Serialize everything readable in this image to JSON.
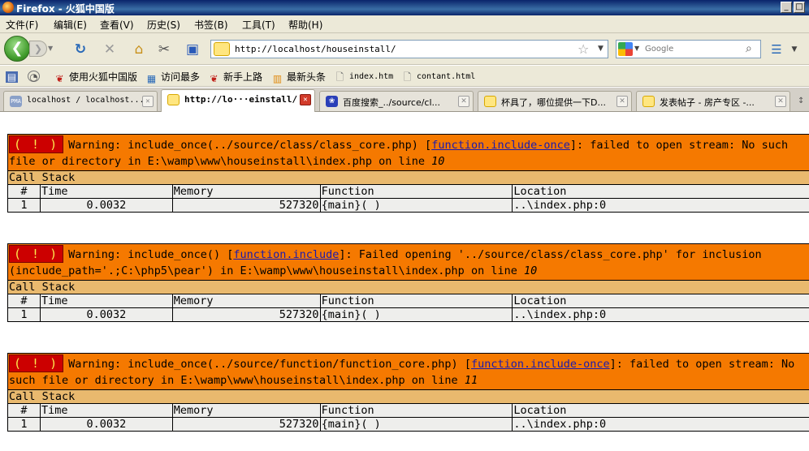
{
  "window": {
    "title": "Firefox - 火狐中国版",
    "buttons": [
      "_",
      "□"
    ]
  },
  "menu": [
    "文件(F)",
    "编辑(E)",
    "查看(V)",
    "历史(S)",
    "书签(B)",
    "工具(T)",
    "帮助(H)"
  ],
  "nav": {
    "url": "http://localhost/houseinstall/",
    "search_placeholder": "Google"
  },
  "bookmarks": [
    {
      "label": "使用火狐中国版",
      "icon": "firefox-china-icon"
    },
    {
      "label": "访问最多",
      "icon": "most-visited-icon"
    },
    {
      "label": "新手上路",
      "icon": "firefox-china-icon"
    },
    {
      "label": "最新头条",
      "icon": "rss-feed-icon"
    },
    {
      "label": "index.htm",
      "icon": "page-icon"
    },
    {
      "label": "contant.html",
      "icon": "page-icon"
    }
  ],
  "tabs": [
    {
      "label": "localhost / localhost...",
      "icon": "phpmyadmin-icon",
      "active": false
    },
    {
      "label": "http://lo···einstall/",
      "icon": "site-icon",
      "active": true
    },
    {
      "label": "百度搜索_../source/cl...",
      "icon": "baidu-icon",
      "active": false
    },
    {
      "label": "杯具了，哪位提供一下D...",
      "icon": "site-icon",
      "active": false
    },
    {
      "label": "发表帖子 - 房产专区 -...",
      "icon": "site-icon",
      "active": false
    }
  ],
  "errors": [
    {
      "badge": "( ! )",
      "text_before": "Warning: include_once(../source/class/class_core.php) [",
      "link": "function.include-once",
      "text_after": "]: failed to open stream: No such file or directory in E:\\wamp\\www\\houseinstall\\index.php on line ",
      "line": "10",
      "stack_title": "Call Stack",
      "headers": [
        "#",
        "Time",
        "Memory",
        "Function",
        "Location"
      ],
      "rows": [
        [
          "1",
          "0.0032",
          "527320",
          "{main}( )",
          "..\\index.php:0"
        ]
      ]
    },
    {
      "badge": "( ! )",
      "text_before": "Warning: include_once() [",
      "link": "function.include",
      "text_after": "]: Failed opening '../source/class/class_core.php' for inclusion (include_path='.;C:\\php5\\pear') in E:\\wamp\\www\\houseinstall\\index.php on line ",
      "line": "10",
      "stack_title": "Call Stack",
      "headers": [
        "#",
        "Time",
        "Memory",
        "Function",
        "Location"
      ],
      "rows": [
        [
          "1",
          "0.0032",
          "527320",
          "{main}( )",
          "..\\index.php:0"
        ]
      ]
    },
    {
      "badge": "( ! )",
      "text_before": "Warning: include_once(../source/function/function_core.php) [",
      "link": "function.include-once",
      "text_after": "]: failed to open stream: No such file or directory in E:\\wamp\\www\\houseinstall\\index.php on line ",
      "line": "11",
      "stack_title": "Call Stack",
      "headers": [
        "#",
        "Time",
        "Memory",
        "Function",
        "Location"
      ],
      "rows": [
        [
          "1",
          "0.0032",
          "527320",
          "{main}( )",
          "..\\index.php:0"
        ]
      ]
    }
  ]
}
